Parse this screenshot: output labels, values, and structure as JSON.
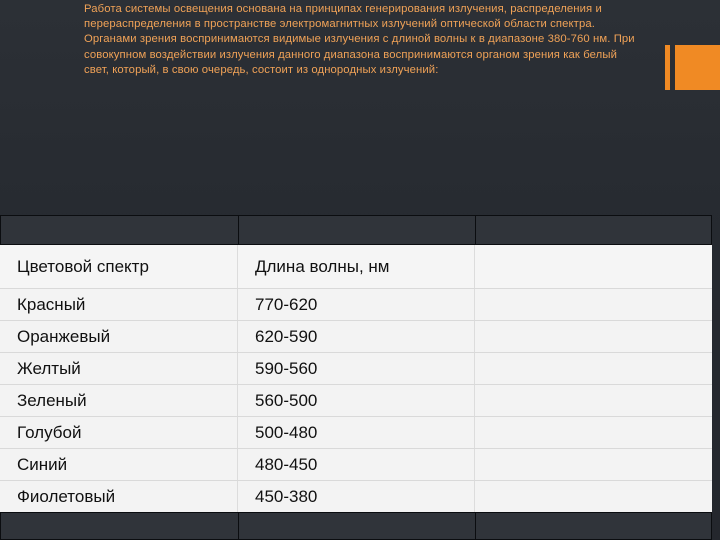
{
  "intro": {
    "text": "Работа системы освещения основана на принципах генерирования излучения, распределения и перераспределения в пространстве электромагнитных излучений оптической области спектра. Органами зрения воспринимаются видимые излучения с длиной волны к в диапазоне 380-760 нм. При совокупном воздействии излучения данного диапазона воспринимаются органом зрения как белый свет, который, в свою очередь, состоит из однородных излучений:"
  },
  "colors": {
    "accent": "#f08a24",
    "text_orange": "#f0a257",
    "background": "#2a2e34"
  },
  "table": {
    "headers": [
      "Цветовой спектр",
      "Длина волны, нм",
      ""
    ],
    "rows": [
      [
        "Красный",
        "770-620",
        ""
      ],
      [
        "Оранжевый",
        "620-590",
        ""
      ],
      [
        "Желтый",
        "590-560",
        ""
      ],
      [
        "Зеленый",
        "560-500",
        ""
      ],
      [
        "Голубой",
        "500-480",
        ""
      ],
      [
        "Синий",
        "480-450",
        ""
      ],
      [
        "Фиолетовый",
        "450-380",
        ""
      ]
    ]
  }
}
